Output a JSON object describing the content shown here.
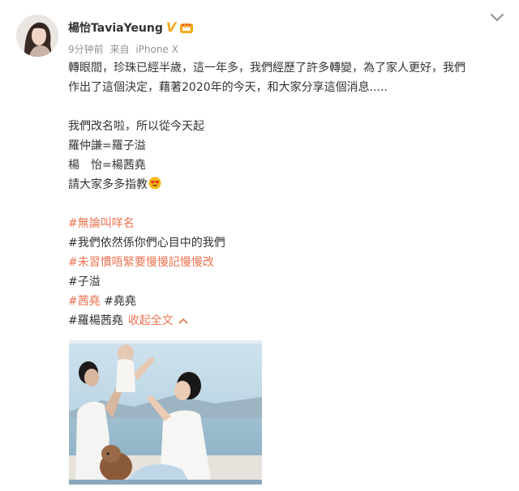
{
  "user": {
    "name": "楊怡TaviaYeung",
    "verified_badge": "V",
    "time": "9分钟前",
    "source_prefix": "来自",
    "device": "iPhone X"
  },
  "post": {
    "lines": [
      "轉眼間，珍珠已經半歲，這一年多，我們經歷了許多轉變，為了家人更好，我們",
      "作出了這個決定，藉著2020年的今天，和大家分享這個消息.....",
      "我們改名啦，所以從今天起",
      "羅仲謙=羅子溢",
      "楊　怡=楊茜堯",
      "請大家多多指教"
    ],
    "tags": [
      "#無論叫咩名",
      "#我們依然係你們心目中的我們",
      "#未習慣唔緊要慢慢記慢慢改",
      "#子溢",
      "#茜堯",
      "#堯堯",
      "#羅楊茜堯"
    ],
    "collapse_label": "收起全文"
  },
  "colors": {
    "link": "#eb7350",
    "text": "#333333",
    "meta": "#939393",
    "verified": "#f7a81b"
  },
  "icons": {
    "more": "chevron-down-icon",
    "emoji": "heart-eyes-emoji",
    "crown": "crown-badge-icon"
  }
}
